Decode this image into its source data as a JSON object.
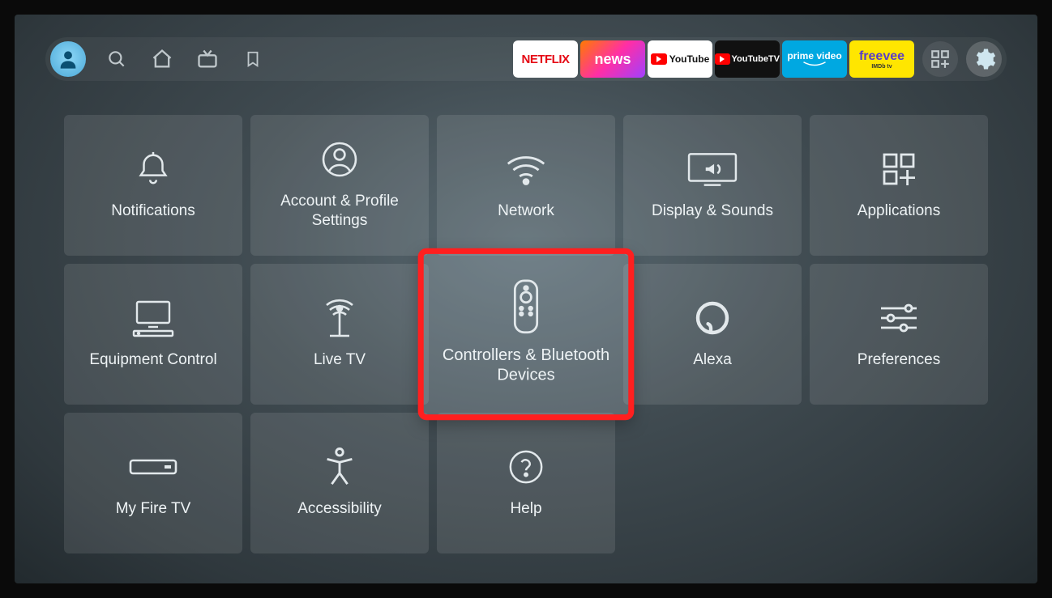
{
  "topbar": {
    "apps": [
      {
        "id": "netflix",
        "label": "NETFLIX"
      },
      {
        "id": "news",
        "label": "news"
      },
      {
        "id": "youtube",
        "label": "YouTube"
      },
      {
        "id": "youtubetv",
        "label": "YouTubeTV"
      },
      {
        "id": "primevideo",
        "label": "prime video"
      },
      {
        "id": "freevee",
        "label": "freevee",
        "sub": "IMDb tv"
      }
    ]
  },
  "settings": {
    "tiles": [
      {
        "id": "notifications",
        "label": "Notifications"
      },
      {
        "id": "account",
        "label": "Account & Profile Settings"
      },
      {
        "id": "network",
        "label": "Network"
      },
      {
        "id": "display",
        "label": "Display & Sounds"
      },
      {
        "id": "applications",
        "label": "Applications"
      },
      {
        "id": "equipment",
        "label": "Equipment Control"
      },
      {
        "id": "livetv",
        "label": "Live TV"
      },
      {
        "id": "controllers",
        "label": "Controllers & Bluetooth Devices",
        "selected": true
      },
      {
        "id": "alexa",
        "label": "Alexa"
      },
      {
        "id": "preferences",
        "label": "Preferences"
      },
      {
        "id": "myfiretv",
        "label": "My Fire TV"
      },
      {
        "id": "accessibility",
        "label": "Accessibility"
      },
      {
        "id": "help",
        "label": "Help"
      }
    ]
  }
}
